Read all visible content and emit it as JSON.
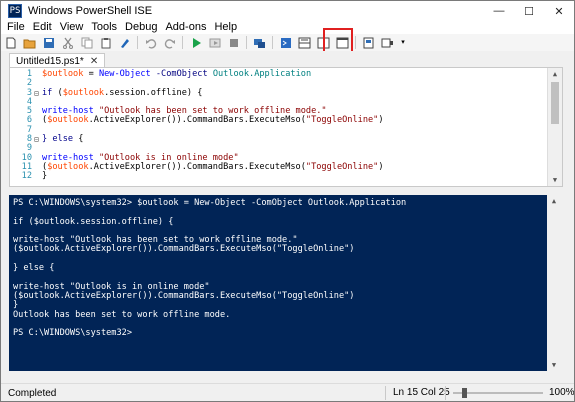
{
  "window": {
    "title": "Windows PowerShell ISE",
    "minimize": "—",
    "maximize": "☐",
    "close": "✕",
    "app_icon": "PS"
  },
  "menu": [
    "File",
    "Edit",
    "View",
    "Tools",
    "Debug",
    "Add-ons",
    "Help"
  ],
  "toolbar": {
    "icons": [
      "new-file-icon",
      "open-folder-icon",
      "save-icon",
      "cut-icon",
      "copy-icon",
      "paste-icon",
      "clear-icon",
      "undo-icon",
      "redo-icon",
      "run-script-icon",
      "run-selection-icon",
      "stop-icon",
      "new-remote-tab-icon",
      "start-powershell-icon",
      "show-script-pane-top-icon",
      "show-script-pane-right-icon",
      "show-script-pane-maximized-icon",
      "show-command-window-icon",
      "show-command-addon-icon"
    ],
    "more": "▾"
  },
  "tab": {
    "label": "Untitled15.ps1*",
    "close": "✕"
  },
  "editor": {
    "line_numbers": [
      "1",
      "2",
      "3",
      "4",
      "5",
      "6",
      "7",
      "8",
      "9",
      "10",
      "11",
      "12"
    ],
    "folds": [
      "",
      "",
      "⊟",
      "",
      "",
      "",
      "",
      "⊟",
      "",
      "",
      "",
      ""
    ]
  },
  "console": {
    "lines": [
      "PS C:\\WINDOWS\\system32> $outlook = New-Object -ComObject Outlook.Application",
      "",
      "if ($outlook.session.offline) {",
      "",
      "write-host \"Outlook has been set to work offline mode.\"",
      "($outlook.ActiveExplorer()).CommandBars.ExecuteMso(\"ToggleOnline\")",
      "",
      "} else {",
      "",
      "write-host \"Outlook is in online mode\"",
      "($outlook.ActiveExplorer()).CommandBars.ExecuteMso(\"ToggleOnline\")",
      "}",
      "Outlook has been set to work offline mode.",
      "",
      "PS C:\\WINDOWS\\system32>"
    ]
  },
  "status": {
    "text": "Completed",
    "position": "Ln 15  Col 25",
    "zoom": "100%",
    "zoom_level": 0.1
  },
  "colors": {
    "console_bg": "#012456",
    "highlight": "#e02020",
    "variable": "#ff4500",
    "cmdlet": "#0000ff",
    "string": "#8b0000"
  }
}
